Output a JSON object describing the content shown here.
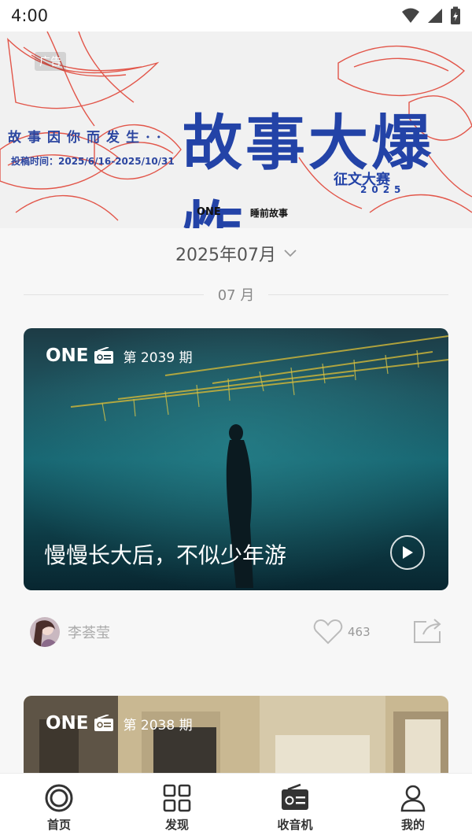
{
  "status_bar": {
    "time": "4:00"
  },
  "banner": {
    "ad_tag": "广告",
    "subtitle": "故事因你而发生··",
    "date": "投稿时间：2025/6/16-2025/10/31",
    "title": "故事大爆炸",
    "contest": "征文大赛",
    "year": "2025",
    "brand": "ONE",
    "partner": "睡前故事"
  },
  "month_selector": {
    "label": "2025年07月"
  },
  "month_divider": {
    "label": "07 月"
  },
  "cards": [
    {
      "brand": "ONE",
      "issue": "第 2039 期",
      "title": "慢慢长大后，不似少年游"
    },
    {
      "brand": "ONE",
      "issue": "第 2038 期"
    }
  ],
  "author": {
    "name": "李荟莹",
    "likes": "463"
  },
  "bottom_nav": [
    {
      "label": "首页",
      "icon": "home-ring-icon"
    },
    {
      "label": "发现",
      "icon": "grid-icon"
    },
    {
      "label": "收音机",
      "icon": "radio-icon"
    },
    {
      "label": "我的",
      "icon": "user-icon"
    }
  ],
  "colors": {
    "banner_blue": "#2343a7",
    "banner_red": "#e2564a"
  }
}
